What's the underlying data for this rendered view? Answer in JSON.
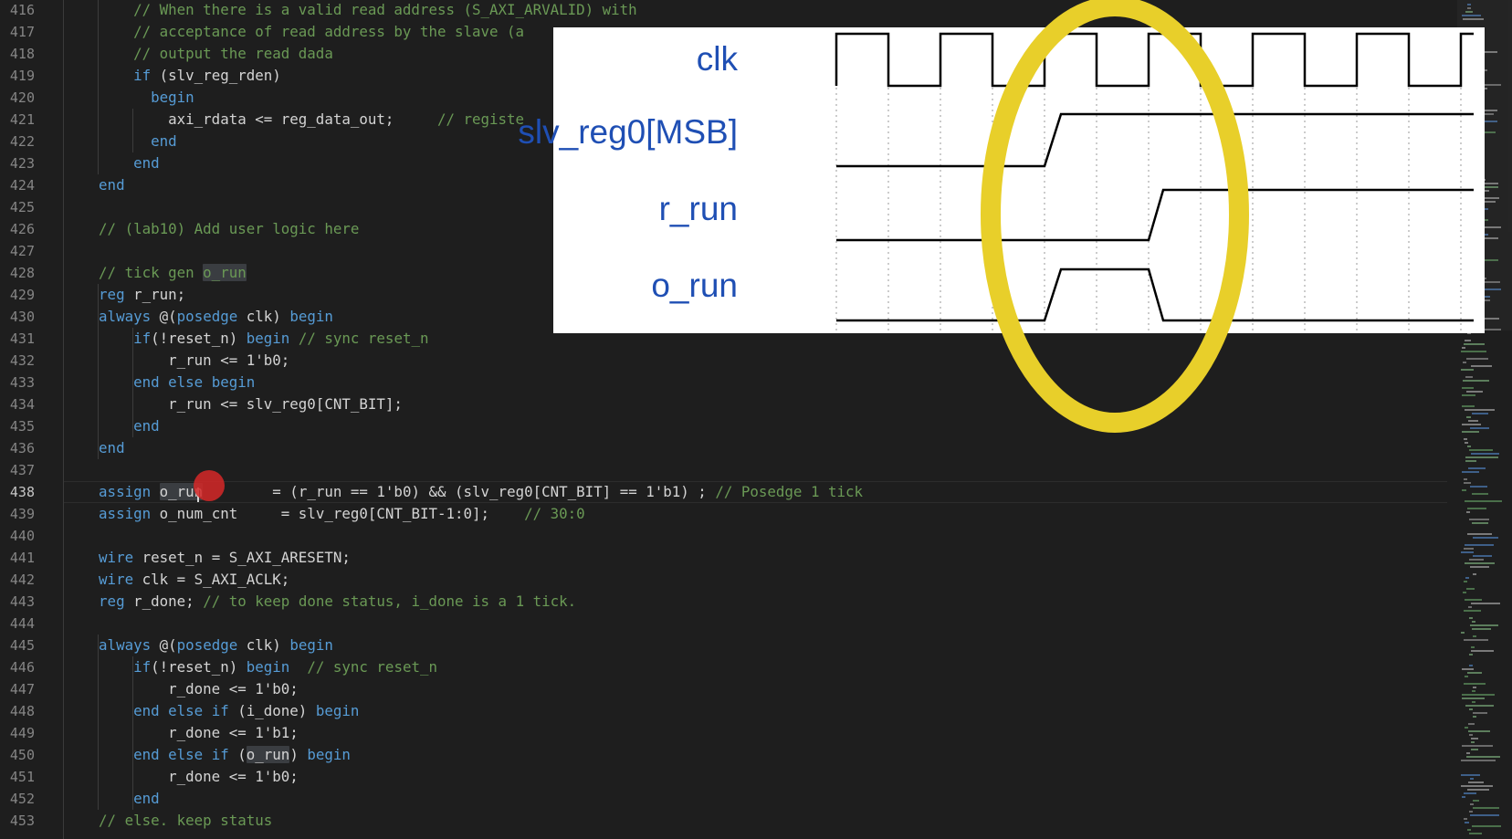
{
  "editor": {
    "line_numbers": [
      "416",
      "417",
      "418",
      "419",
      "420",
      "421",
      "422",
      "423",
      "424",
      "425",
      "426",
      "427",
      "428",
      "429",
      "430",
      "431",
      "432",
      "433",
      "434",
      "435",
      "436",
      "437",
      "438",
      "439",
      "440",
      "441",
      "442",
      "443",
      "444",
      "445",
      "446",
      "447",
      "448",
      "449",
      "450",
      "451",
      "452",
      "453"
    ],
    "current_line": "438",
    "lines": [
      [
        {
          "t": "        // When there is a valid read address (S_AXI_ARVALID) with",
          "c": "c"
        }
      ],
      [
        {
          "t": "        // acceptance of read address by the slave (a",
          "c": "c"
        }
      ],
      [
        {
          "t": "        // output the read dada",
          "c": "c"
        }
      ],
      [
        {
          "t": "        ",
          "c": "t"
        },
        {
          "t": "if",
          "c": "k"
        },
        {
          "t": " (slv_reg_rden)",
          "c": "t"
        }
      ],
      [
        {
          "t": "          ",
          "c": "t"
        },
        {
          "t": "begin",
          "c": "k"
        }
      ],
      [
        {
          "t": "            axi_rdata <= reg_data_out;     ",
          "c": "t"
        },
        {
          "t": "// registe",
          "c": "c"
        }
      ],
      [
        {
          "t": "          ",
          "c": "t"
        },
        {
          "t": "end",
          "c": "k"
        }
      ],
      [
        {
          "t": "        ",
          "c": "t"
        },
        {
          "t": "end",
          "c": "k"
        }
      ],
      [
        {
          "t": "    ",
          "c": "t"
        },
        {
          "t": "end",
          "c": "k"
        }
      ],
      [],
      [
        {
          "t": "    // (lab10) Add user logic here",
          "c": "c"
        }
      ],
      [],
      [
        {
          "t": "    // tick gen ",
          "c": "c"
        },
        {
          "t": "o_run",
          "c": "c",
          "h": 1
        }
      ],
      [
        {
          "t": "    ",
          "c": "t"
        },
        {
          "t": "reg",
          "c": "k"
        },
        {
          "t": " r_run;",
          "c": "t"
        }
      ],
      [
        {
          "t": "    ",
          "c": "t"
        },
        {
          "t": "always",
          "c": "k"
        },
        {
          "t": " @(",
          "c": "t"
        },
        {
          "t": "posedge",
          "c": "k"
        },
        {
          "t": " clk) ",
          "c": "t"
        },
        {
          "t": "begin",
          "c": "k"
        }
      ],
      [
        {
          "t": "        ",
          "c": "t"
        },
        {
          "t": "if",
          "c": "k"
        },
        {
          "t": "(!reset_n) ",
          "c": "t"
        },
        {
          "t": "begin",
          "c": "k"
        },
        {
          "t": " // sync reset_n",
          "c": "c"
        }
      ],
      [
        {
          "t": "            r_run <= 1'b0;",
          "c": "t"
        }
      ],
      [
        {
          "t": "        ",
          "c": "t"
        },
        {
          "t": "end else begin",
          "c": "k"
        }
      ],
      [
        {
          "t": "            r_run <= slv_reg0[CNT_BIT];",
          "c": "t"
        }
      ],
      [
        {
          "t": "        ",
          "c": "t"
        },
        {
          "t": "end",
          "c": "k"
        }
      ],
      [
        {
          "t": "    ",
          "c": "t"
        },
        {
          "t": "end",
          "c": "k"
        }
      ],
      [],
      [
        {
          "t": "    ",
          "c": "t"
        },
        {
          "t": "assign",
          "c": "k"
        },
        {
          "t": " ",
          "c": "t"
        },
        {
          "t": "o_run",
          "c": "t",
          "h": 1
        },
        {
          "t": "        = (r_run == 1'b0) && (slv_reg0[CNT_BIT] == 1'b1) ; ",
          "c": "t"
        },
        {
          "t": "// Posedge 1 tick",
          "c": "c"
        }
      ],
      [
        {
          "t": "    ",
          "c": "t"
        },
        {
          "t": "assign",
          "c": "k"
        },
        {
          "t": " o_num_cnt     = slv_reg0[CNT_BIT-1:0];    ",
          "c": "t"
        },
        {
          "t": "// 30:0",
          "c": "c"
        }
      ],
      [],
      [
        {
          "t": "    ",
          "c": "t"
        },
        {
          "t": "wire",
          "c": "k"
        },
        {
          "t": " reset_n = S_AXI_ARESETN;",
          "c": "t"
        }
      ],
      [
        {
          "t": "    ",
          "c": "t"
        },
        {
          "t": "wire",
          "c": "k"
        },
        {
          "t": " clk = S_AXI_ACLK;",
          "c": "t"
        }
      ],
      [
        {
          "t": "    ",
          "c": "t"
        },
        {
          "t": "reg",
          "c": "k"
        },
        {
          "t": " r_done; ",
          "c": "t"
        },
        {
          "t": "// to keep done status, i_done is a 1 tick.",
          "c": "c"
        }
      ],
      [],
      [
        {
          "t": "    ",
          "c": "t"
        },
        {
          "t": "always",
          "c": "k"
        },
        {
          "t": " @(",
          "c": "t"
        },
        {
          "t": "posedge",
          "c": "k"
        },
        {
          "t": " clk) ",
          "c": "t"
        },
        {
          "t": "begin",
          "c": "k"
        }
      ],
      [
        {
          "t": "        ",
          "c": "t"
        },
        {
          "t": "if",
          "c": "k"
        },
        {
          "t": "(!reset_n) ",
          "c": "t"
        },
        {
          "t": "begin",
          "c": "k"
        },
        {
          "t": "  // sync reset_n",
          "c": "c"
        }
      ],
      [
        {
          "t": "            r_done <= 1'b0;",
          "c": "t"
        }
      ],
      [
        {
          "t": "        ",
          "c": "t"
        },
        {
          "t": "end else if",
          "c": "k"
        },
        {
          "t": " (i_done) ",
          "c": "t"
        },
        {
          "t": "begin",
          "c": "k"
        }
      ],
      [
        {
          "t": "            r_done <= 1'b1;",
          "c": "t"
        }
      ],
      [
        {
          "t": "        ",
          "c": "t"
        },
        {
          "t": "end else if",
          "c": "k"
        },
        {
          "t": " (",
          "c": "t"
        },
        {
          "t": "o_run",
          "c": "t",
          "h": 1
        },
        {
          "t": ") ",
          "c": "t"
        },
        {
          "t": "begin",
          "c": "k"
        }
      ],
      [
        {
          "t": "            r_done <= 1'b0;",
          "c": "t"
        }
      ],
      [
        {
          "t": "        ",
          "c": "t"
        },
        {
          "t": "end",
          "c": "k"
        }
      ],
      [
        {
          "t": "    // else. keep status",
          "c": "c"
        }
      ]
    ]
  },
  "timing_diagram": {
    "signals": [
      "clk",
      "slv_reg0[MSB]",
      "r_run",
      "o_run"
    ],
    "colors": {
      "label": "#1f4fb4",
      "wave": "#000000",
      "highlight": "#e8cf2a"
    }
  }
}
